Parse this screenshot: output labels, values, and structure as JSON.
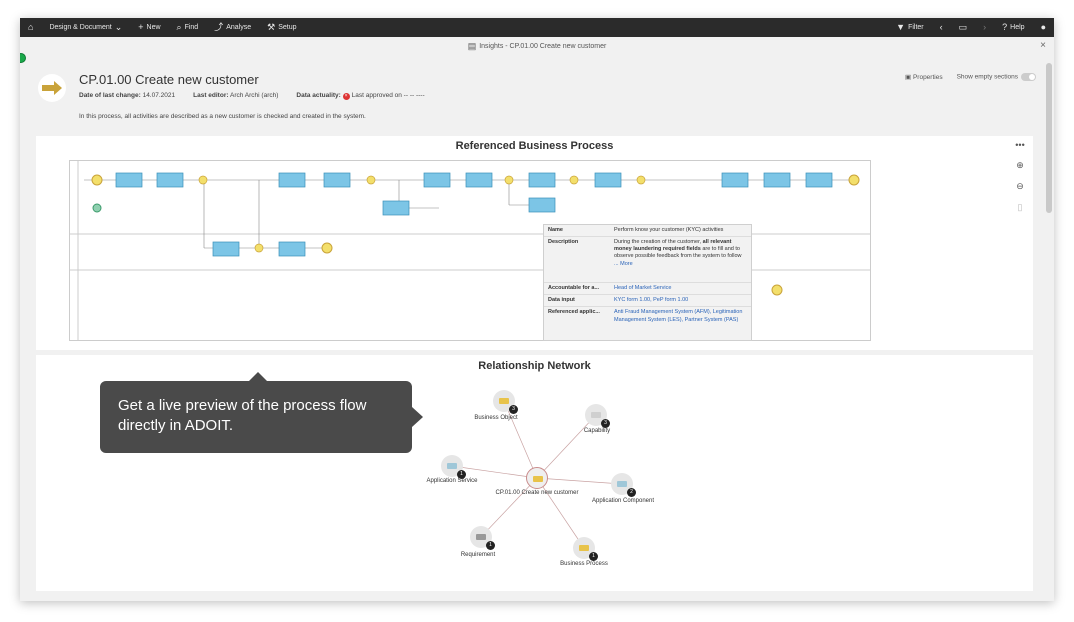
{
  "topbar": {
    "home_icon": "home-icon",
    "menu_design": "Design & Document",
    "menu_new": "New",
    "menu_find": "Find",
    "menu_analyse": "Analyse",
    "menu_setup": "Setup",
    "filter": "Filter",
    "help": "Help"
  },
  "window": {
    "title": "Insights - CP.01.00 Create new customer"
  },
  "object": {
    "title": "CP.01.00 Create new customer",
    "last_change_label": "Date of last change:",
    "last_change_value": "14.07.2021",
    "last_editor_label": "Last editor:",
    "last_editor_value": "Arch Archi (arch)",
    "actuality_label": "Data actuality:",
    "actuality_value": "Last approved on -- -- ----",
    "description": "In this process, all activities are described as a new customer is checked and created in the system.",
    "properties_label": "Properties",
    "show_empty_label": "Show empty sections"
  },
  "process_panel": {
    "title": "Referenced Business Process"
  },
  "popup": {
    "name_label": "Name",
    "name_value": "Perform know your customer (KYC) activities",
    "description_label": "Description",
    "description_pre": "During the creation of the customer,",
    "description_bold": "all relevant money laundering required fields",
    "description_post": "are to fill and to observe possible feedback from the system to follow",
    "more": "... More",
    "accountable_label": "Accountable for a...",
    "accountable_value": "Head of Market Service",
    "data_input_label": "Data input",
    "data_input_value": "KYC form 1.00, PeP form 1.00",
    "ref_app_label": "Referenced applic...",
    "ref_app_value": "Anti Fraud Management System (AFM), Legitimation Management System (LES), Partner System (PAS)"
  },
  "network_panel": {
    "title": "Relationship Network",
    "center": "CP.01.00 Create new customer",
    "nodes": [
      {
        "label": "Business Object",
        "count": "3",
        "color": "#e8c34a"
      },
      {
        "label": "Capability",
        "count": "3",
        "color": "#cfcfcf"
      },
      {
        "label": "Application Service",
        "count": "1",
        "color": "#9fc7d8"
      },
      {
        "label": "Application Component",
        "count": "2",
        "color": "#9fc7d8"
      },
      {
        "label": "Requirement",
        "count": "1",
        "color": "#999999"
      },
      {
        "label": "Business Process",
        "count": "1",
        "color": "#e8c34a"
      }
    ]
  },
  "tooltip": {
    "text": "Get a live preview of the process flow directly in ADOIT."
  }
}
